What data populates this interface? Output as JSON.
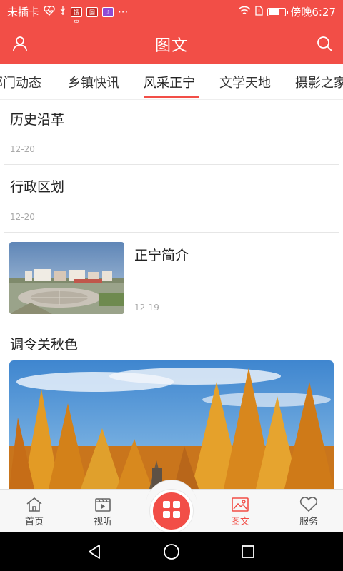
{
  "status_bar": {
    "carrier": "未插卡",
    "app_badge_1": "饿鬼",
    "app_badge_2": "国",
    "dots": "···",
    "time": "傍晚6:27",
    "battery_level": 0.6
  },
  "header": {
    "title": "图文",
    "left_icon": "user-icon",
    "right_icon": "search-icon"
  },
  "tabs": [
    {
      "label": "部门动态",
      "active": false
    },
    {
      "label": "乡镇快讯",
      "active": false
    },
    {
      "label": "风采正宁",
      "active": true
    },
    {
      "label": "文学天地",
      "active": false
    },
    {
      "label": "摄影之家",
      "active": false
    }
  ],
  "articles": [
    {
      "title": "历史沿革",
      "date": "12-20"
    },
    {
      "title": "行政区划",
      "date": "12-20"
    },
    {
      "title": "正宁简介",
      "date": "12-19",
      "thumbnail": "town-square-photo"
    },
    {
      "title": "调令关秋色",
      "image": "autumn-larch-forest-photo"
    }
  ],
  "bottom_nav": {
    "items": [
      {
        "label": "首页",
        "icon": "home-icon"
      },
      {
        "label": "视听",
        "icon": "video-icon"
      },
      {
        "label": "",
        "icon": "grid-icon"
      },
      {
        "label": "图文",
        "icon": "image-icon",
        "active": true
      },
      {
        "label": "服务",
        "icon": "heart-icon"
      }
    ]
  },
  "colors": {
    "accent": "#f24e47",
    "text": "#222222",
    "muted": "#aaaaaa"
  }
}
